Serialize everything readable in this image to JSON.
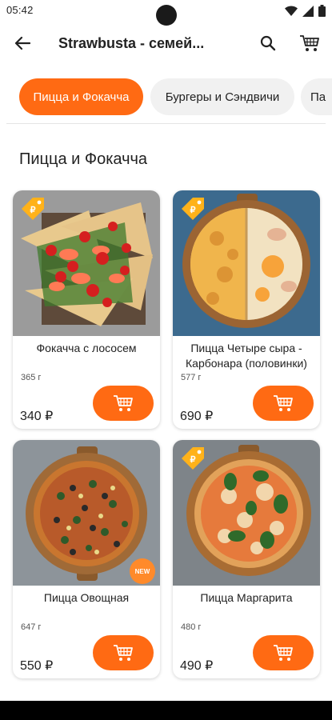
{
  "status_bar": {
    "time": "05:42"
  },
  "app_bar": {
    "title": "Strawbusta - семей..."
  },
  "tabs": [
    {
      "label": "Пицца и Фокачча",
      "active": true
    },
    {
      "label": "Бургеры и Сэндвичи",
      "active": false
    },
    {
      "label": "Па",
      "active": false
    }
  ],
  "section": {
    "title": "Пицца и Фокачча"
  },
  "products": [
    {
      "name": "Фокачча с лососем",
      "weight": "365 г",
      "price": "340 ₽",
      "badge": "tag"
    },
    {
      "name": "Пицца Четыре сыра - Карбонара (половинки)",
      "weight": "577 г",
      "price": "690 ₽",
      "badge": "tag"
    },
    {
      "name": "Пицца Овощная",
      "weight": "647 г",
      "price": "550 ₽",
      "badge": "new",
      "badge_text": "NEW"
    },
    {
      "name": "Пицца Маргарита",
      "weight": "480 г",
      "price": "490 ₽",
      "badge": "tag"
    }
  ],
  "colors": {
    "accent": "#ff6a13",
    "tab_inactive": "#f1f1f1",
    "badge_tag": "#ffb21a"
  }
}
